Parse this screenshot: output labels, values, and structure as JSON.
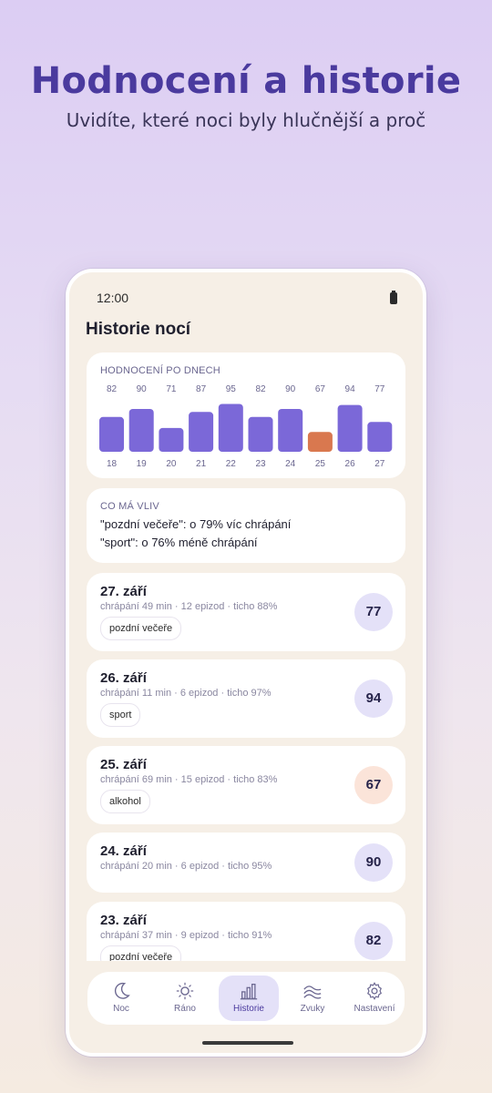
{
  "hero": {
    "title": "Hodnocení a historie",
    "subtitle": "Uvidíte, které noci byly hlučnější a proč"
  },
  "status": {
    "time": "12:00"
  },
  "screen": {
    "title": "Historie nocí"
  },
  "chart_data": {
    "type": "bar",
    "title": "HODNOCENÍ PO DNECH",
    "categories": [
      "18",
      "19",
      "20",
      "21",
      "22",
      "23",
      "24",
      "25",
      "26",
      "27"
    ],
    "values": [
      82,
      90,
      71,
      87,
      95,
      82,
      90,
      67,
      94,
      77
    ],
    "ylim": [
      0,
      100
    ],
    "colors": {
      "normal": "#7b68d8",
      "highlight": "#d9784f"
    },
    "highlight_index": 7
  },
  "influence": {
    "label": "CO MÁ VLIV",
    "lines": [
      "\"pozdní večeře\": o 79% víc chrápání",
      "\"sport\": o 76% méně chrápání"
    ]
  },
  "nights": [
    {
      "date": "27. září",
      "stats": "chrápání 49 min · 12 epizod · ticho 88%",
      "tag": "pozdní večeře",
      "score": "77"
    },
    {
      "date": "26. září",
      "stats": "chrápání 11 min · 6 epizod · ticho 97%",
      "tag": "sport",
      "score": "94"
    },
    {
      "date": "25. září",
      "stats": "chrápání 69 min · 15 epizod · ticho 83%",
      "tag": "alkohol",
      "score": "67"
    },
    {
      "date": "24. září",
      "stats": "chrápání 20 min · 6 epizod · ticho 95%",
      "tag": "",
      "score": "90"
    },
    {
      "date": "23. září",
      "stats": "chrápání 37 min · 9 epizod · ticho 91%",
      "tag": "pozdní večeře",
      "score": "82"
    }
  ],
  "nav": [
    {
      "label": "Noc",
      "icon": "moon-icon"
    },
    {
      "label": "Ráno",
      "icon": "sun-icon"
    },
    {
      "label": "Historie",
      "icon": "bar-chart-icon"
    },
    {
      "label": "Zvuky",
      "icon": "waves-icon"
    },
    {
      "label": "Nastavení",
      "icon": "gear-icon"
    }
  ],
  "nav_active_index": 2
}
